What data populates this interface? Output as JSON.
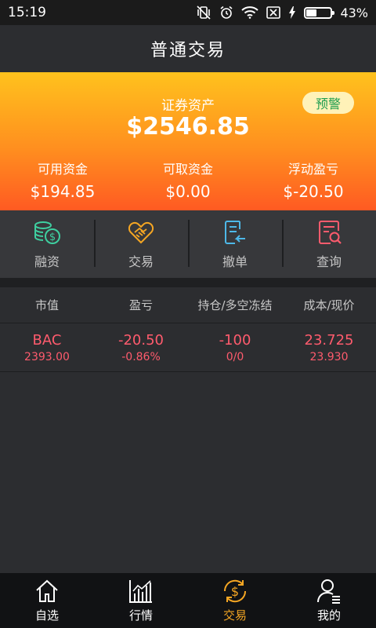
{
  "status_bar": {
    "time": "15:19",
    "battery_percent": "43%",
    "battery_level": 0.43
  },
  "header": {
    "title": "普通交易"
  },
  "summary": {
    "assets_label": "证券资产",
    "assets_value": "$2546.85",
    "warning_button": "预警",
    "stats": [
      {
        "label": "可用资金",
        "value": "$194.85"
      },
      {
        "label": "可取资金",
        "value": "$0.00"
      },
      {
        "label": "浮动盈亏",
        "value": "$-20.50"
      }
    ]
  },
  "actions": [
    {
      "label": "融资",
      "icon": "coins-icon"
    },
    {
      "label": "交易",
      "icon": "handshake-icon"
    },
    {
      "label": "撤单",
      "icon": "cancel-order-icon"
    },
    {
      "label": "查询",
      "icon": "search-document-icon"
    }
  ],
  "table": {
    "headers": [
      "市值",
      "盈亏",
      "持仓/多空冻结",
      "成本/现价"
    ],
    "rows": [
      {
        "symbol": "BAC",
        "market_value": "2393.00",
        "pnl": "-20.50",
        "pnl_pct": "-0.86%",
        "position": "-100",
        "frozen": "0/0",
        "cost": "23.725",
        "price": "23.930"
      }
    ]
  },
  "tabs": [
    {
      "label": "自选",
      "icon": "home-icon",
      "active": false
    },
    {
      "label": "行情",
      "icon": "chart-icon",
      "active": false
    },
    {
      "label": "交易",
      "icon": "dollar-cycle-icon",
      "active": true
    },
    {
      "label": "我的",
      "icon": "user-icon",
      "active": false
    }
  ],
  "colors": {
    "accent": "#f5a623",
    "loss": "#ff5b6d",
    "warning_text": "#1d9e50"
  }
}
